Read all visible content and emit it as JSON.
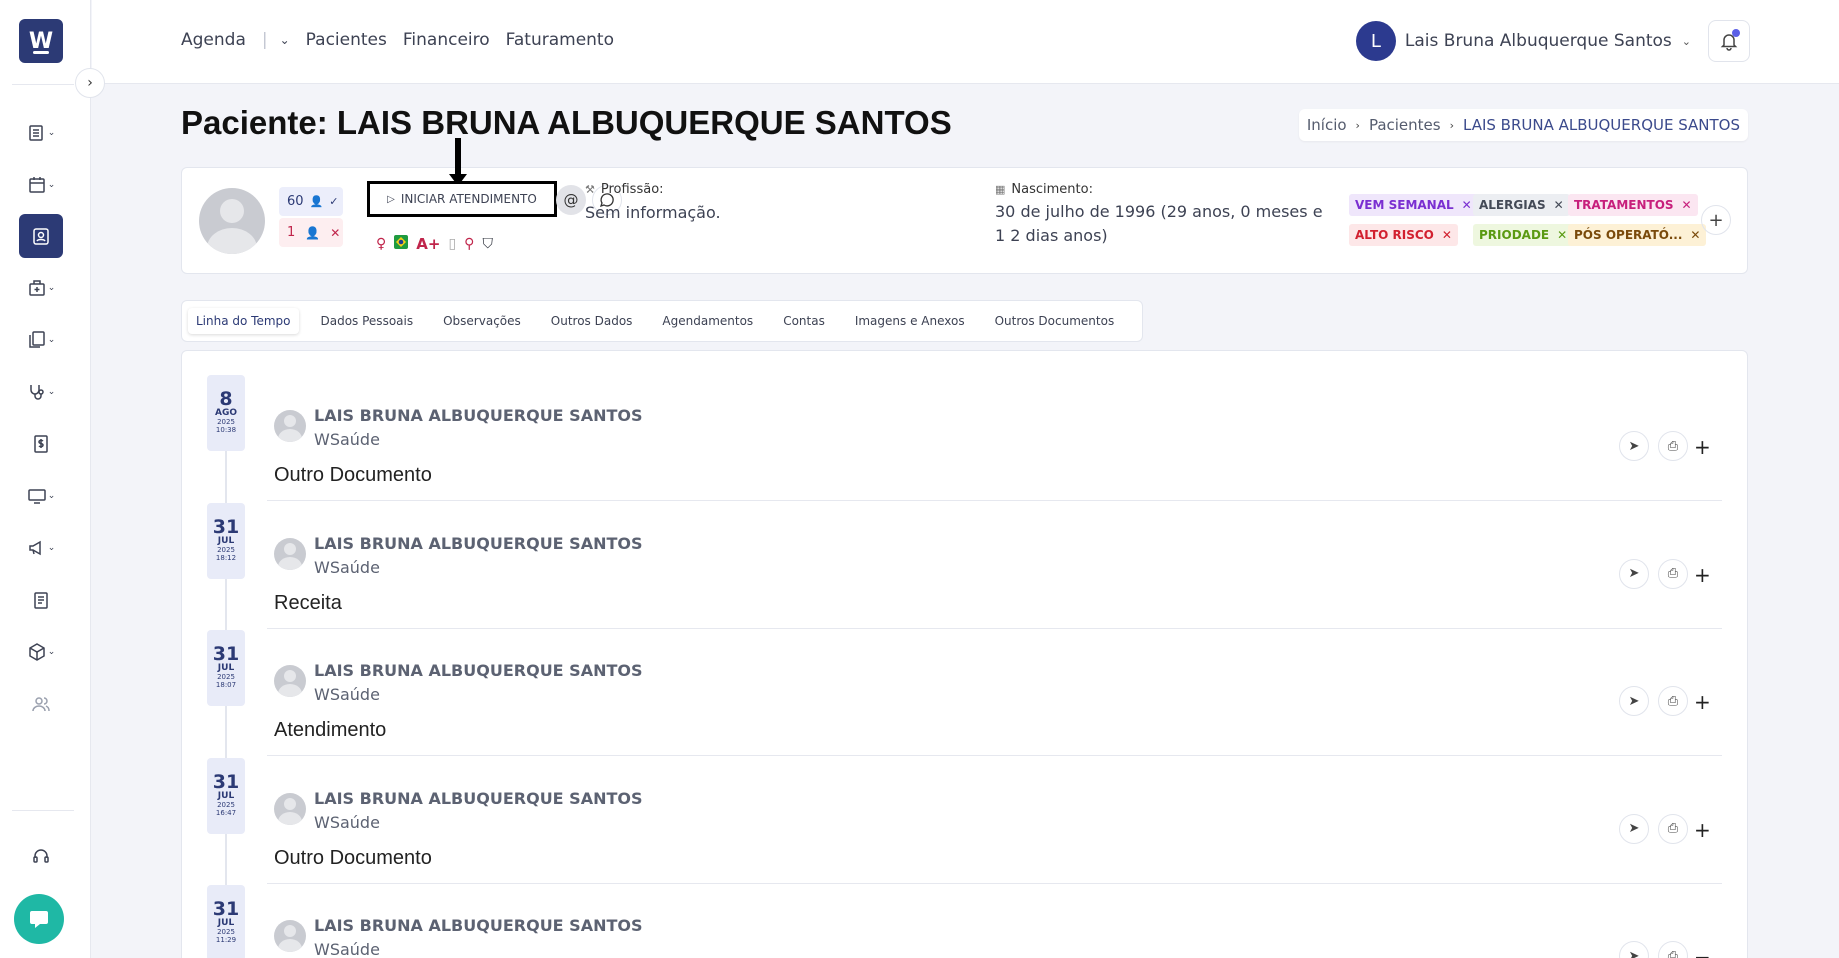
{
  "nav": {
    "items": [
      "Agenda",
      "Pacientes",
      "Financeiro",
      "Faturamento"
    ],
    "agenda_label": "Agenda",
    "pacientes_label": "Pacientes",
    "financeiro_label": "Financeiro",
    "faturamento_label": "Faturamento"
  },
  "user": {
    "initial": "L",
    "name": "Lais Bruna Albuquerque Santos"
  },
  "logo": {
    "letter": "W"
  },
  "page": {
    "title": "Paciente: LAIS BRUNA ALBUQUERQUE SANTOS"
  },
  "breadcrumb": {
    "home": "Início",
    "patients": "Pacientes",
    "current": "LAIS BRUNA ALBUQUERQUE SANTOS"
  },
  "patient": {
    "stat_confirmed": "60",
    "stat_missed": "1",
    "start_button": "INICIAR ATENDIMENTO",
    "blood_type": "A+",
    "profession_label": "Profissão:",
    "profession_value": "Sem informação.",
    "birth_label": "Nascimento:",
    "birth_value": "30 de julho de 1996 (29 anos, 0 meses e 1 2 dias anos)"
  },
  "tags": [
    {
      "label": "VEM SEMANAL",
      "color": "#7a2fd1",
      "bg": "#efe6fb"
    },
    {
      "label": "ALERGIAS",
      "color": "#444a57",
      "bg": "#eceef2"
    },
    {
      "label": "TRATAMENTOS",
      "color": "#c71f7c",
      "bg": "#fbe6f1"
    },
    {
      "label": "ALTO RISCO",
      "color": "#d2202f",
      "bg": "#fde7e8"
    },
    {
      "label": "PRIODADE",
      "color": "#5a9a12",
      "bg": "#eef7df"
    },
    {
      "label": "PÓS OPERATÓ...",
      "color": "#7a4a0b",
      "bg": "#fdf1d6"
    }
  ],
  "tabs": [
    "Linha do Tempo",
    "Dados Pessoais",
    "Observações",
    "Outros Dados",
    "Agendamentos",
    "Contas",
    "Imagens e Anexos",
    "Outros Documentos"
  ],
  "timeline": [
    {
      "day": "8",
      "month": "AGO",
      "year": "2025",
      "time": "10:38",
      "name": "LAIS BRUNA ALBUQUERQUE SANTOS",
      "org": "WSaúde",
      "type": "Outro Documento"
    },
    {
      "day": "31",
      "month": "JUL",
      "year": "2025",
      "time": "18:12",
      "name": "LAIS BRUNA ALBUQUERQUE SANTOS",
      "org": "WSaúde",
      "type": "Receita"
    },
    {
      "day": "31",
      "month": "JUL",
      "year": "2025",
      "time": "18:07",
      "name": "LAIS BRUNA ALBUQUERQUE SANTOS",
      "org": "WSaúde",
      "type": "Atendimento"
    },
    {
      "day": "31",
      "month": "JUL",
      "year": "2025",
      "time": "16:47",
      "name": "LAIS BRUNA ALBUQUERQUE SANTOS",
      "org": "WSaúde",
      "type": "Outro Documento"
    },
    {
      "day": "31",
      "month": "JUL",
      "year": "2025",
      "time": "11:29",
      "name": "LAIS BRUNA ALBUQUERQUE SANTOS",
      "org": "WSaúde",
      "type": ""
    }
  ],
  "icons": {
    "sidebar": [
      "list-icon",
      "calendar-icon",
      "patient-card-icon",
      "hospital-icon",
      "documents-icon",
      "stethoscope-icon",
      "dollar-icon",
      "monitor-icon",
      "megaphone-icon",
      "report-icon",
      "box-icon",
      "users-icon",
      "headset-icon"
    ]
  },
  "colors": {
    "brand": "#2c3a75",
    "accent": "#1fb8a5"
  }
}
